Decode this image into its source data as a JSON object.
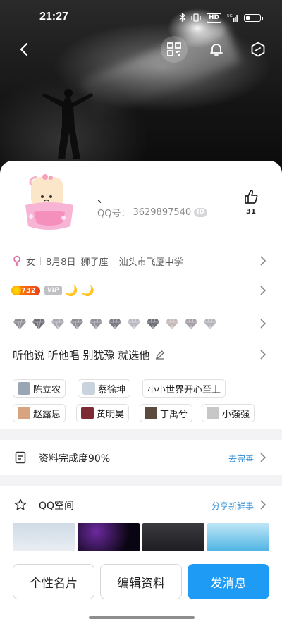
{
  "status_bar": {
    "time": "21:27",
    "hd_label": "HD",
    "net_label": "5G"
  },
  "profile": {
    "name": "、",
    "qq_label": "QQ号：",
    "qq_number": "3629897540",
    "id_badge": "ID",
    "like_count": "31"
  },
  "info": {
    "gender": "女",
    "birthday": "8月8日",
    "zodiac": "狮子座",
    "school": "汕头市飞厦中学"
  },
  "badges": {
    "level": "732",
    "vip": "VIP",
    "moons": "🌙 🌙"
  },
  "gems": [
    "gem",
    "gem",
    "gem",
    "gem",
    "gem",
    "gem",
    "gem",
    "gem",
    "gem",
    "gem",
    "gem"
  ],
  "signature": "听他说 听他唱 别犹豫 就选他",
  "tags": [
    {
      "label": "陈立农",
      "thumb": "#9aa6b3"
    },
    {
      "label": "蔡徐坤",
      "thumb": "#c9d3dd"
    },
    {
      "label": "小小世界开心至上",
      "thumb": ""
    },
    {
      "label": "赵露思",
      "thumb": "#d8a37f"
    },
    {
      "label": "黄明昊",
      "thumb": "#7c2b35"
    },
    {
      "label": "丁禹兮",
      "thumb": "#5d4a3f"
    },
    {
      "label": "小强强",
      "thumb": "#c7c7c7"
    }
  ],
  "completion": {
    "title": "资料完成度90%",
    "action": "去完善"
  },
  "qzone": {
    "title": "QQ空间",
    "action": "分享新鲜事"
  },
  "buttons": {
    "card": "个性名片",
    "edit": "编辑资料",
    "message": "发消息"
  },
  "colors": {
    "accent": "#1e9bf5",
    "link": "#2e8ed6"
  }
}
